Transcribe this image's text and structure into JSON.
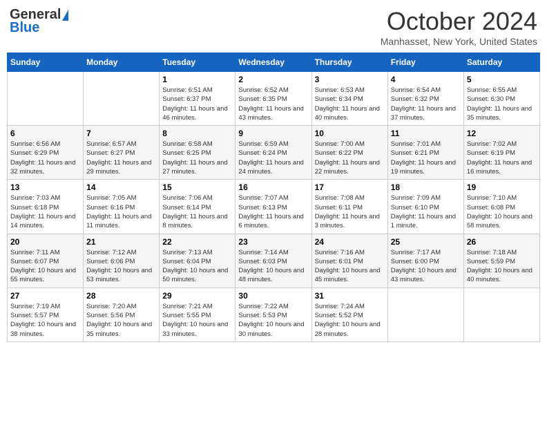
{
  "logo": {
    "general": "General",
    "blue": "Blue"
  },
  "title": "October 2024",
  "location": "Manhasset, New York, United States",
  "weekdays": [
    "Sunday",
    "Monday",
    "Tuesday",
    "Wednesday",
    "Thursday",
    "Friday",
    "Saturday"
  ],
  "weeks": [
    [
      {
        "day": "",
        "info": ""
      },
      {
        "day": "",
        "info": ""
      },
      {
        "day": "1",
        "info": "Sunrise: 6:51 AM\nSunset: 6:37 PM\nDaylight: 11 hours and 46 minutes."
      },
      {
        "day": "2",
        "info": "Sunrise: 6:52 AM\nSunset: 6:35 PM\nDaylight: 11 hours and 43 minutes."
      },
      {
        "day": "3",
        "info": "Sunrise: 6:53 AM\nSunset: 6:34 PM\nDaylight: 11 hours and 40 minutes."
      },
      {
        "day": "4",
        "info": "Sunrise: 6:54 AM\nSunset: 6:32 PM\nDaylight: 11 hours and 37 minutes."
      },
      {
        "day": "5",
        "info": "Sunrise: 6:55 AM\nSunset: 6:30 PM\nDaylight: 11 hours and 35 minutes."
      }
    ],
    [
      {
        "day": "6",
        "info": "Sunrise: 6:56 AM\nSunset: 6:29 PM\nDaylight: 11 hours and 32 minutes."
      },
      {
        "day": "7",
        "info": "Sunrise: 6:57 AM\nSunset: 6:27 PM\nDaylight: 11 hours and 29 minutes."
      },
      {
        "day": "8",
        "info": "Sunrise: 6:58 AM\nSunset: 6:25 PM\nDaylight: 11 hours and 27 minutes."
      },
      {
        "day": "9",
        "info": "Sunrise: 6:59 AM\nSunset: 6:24 PM\nDaylight: 11 hours and 24 minutes."
      },
      {
        "day": "10",
        "info": "Sunrise: 7:00 AM\nSunset: 6:22 PM\nDaylight: 11 hours and 22 minutes."
      },
      {
        "day": "11",
        "info": "Sunrise: 7:01 AM\nSunset: 6:21 PM\nDaylight: 11 hours and 19 minutes."
      },
      {
        "day": "12",
        "info": "Sunrise: 7:02 AM\nSunset: 6:19 PM\nDaylight: 11 hours and 16 minutes."
      }
    ],
    [
      {
        "day": "13",
        "info": "Sunrise: 7:03 AM\nSunset: 6:18 PM\nDaylight: 11 hours and 14 minutes."
      },
      {
        "day": "14",
        "info": "Sunrise: 7:05 AM\nSunset: 6:16 PM\nDaylight: 11 hours and 11 minutes."
      },
      {
        "day": "15",
        "info": "Sunrise: 7:06 AM\nSunset: 6:14 PM\nDaylight: 11 hours and 8 minutes."
      },
      {
        "day": "16",
        "info": "Sunrise: 7:07 AM\nSunset: 6:13 PM\nDaylight: 11 hours and 6 minutes."
      },
      {
        "day": "17",
        "info": "Sunrise: 7:08 AM\nSunset: 6:11 PM\nDaylight: 11 hours and 3 minutes."
      },
      {
        "day": "18",
        "info": "Sunrise: 7:09 AM\nSunset: 6:10 PM\nDaylight: 11 hours and 1 minute."
      },
      {
        "day": "19",
        "info": "Sunrise: 7:10 AM\nSunset: 6:08 PM\nDaylight: 10 hours and 58 minutes."
      }
    ],
    [
      {
        "day": "20",
        "info": "Sunrise: 7:11 AM\nSunset: 6:07 PM\nDaylight: 10 hours and 55 minutes."
      },
      {
        "day": "21",
        "info": "Sunrise: 7:12 AM\nSunset: 6:06 PM\nDaylight: 10 hours and 53 minutes."
      },
      {
        "day": "22",
        "info": "Sunrise: 7:13 AM\nSunset: 6:04 PM\nDaylight: 10 hours and 50 minutes."
      },
      {
        "day": "23",
        "info": "Sunrise: 7:14 AM\nSunset: 6:03 PM\nDaylight: 10 hours and 48 minutes."
      },
      {
        "day": "24",
        "info": "Sunrise: 7:16 AM\nSunset: 6:01 PM\nDaylight: 10 hours and 45 minutes."
      },
      {
        "day": "25",
        "info": "Sunrise: 7:17 AM\nSunset: 6:00 PM\nDaylight: 10 hours and 43 minutes."
      },
      {
        "day": "26",
        "info": "Sunrise: 7:18 AM\nSunset: 5:59 PM\nDaylight: 10 hours and 40 minutes."
      }
    ],
    [
      {
        "day": "27",
        "info": "Sunrise: 7:19 AM\nSunset: 5:57 PM\nDaylight: 10 hours and 38 minutes."
      },
      {
        "day": "28",
        "info": "Sunrise: 7:20 AM\nSunset: 5:56 PM\nDaylight: 10 hours and 35 minutes."
      },
      {
        "day": "29",
        "info": "Sunrise: 7:21 AM\nSunset: 5:55 PM\nDaylight: 10 hours and 33 minutes."
      },
      {
        "day": "30",
        "info": "Sunrise: 7:22 AM\nSunset: 5:53 PM\nDaylight: 10 hours and 30 minutes."
      },
      {
        "day": "31",
        "info": "Sunrise: 7:24 AM\nSunset: 5:52 PM\nDaylight: 10 hours and 28 minutes."
      },
      {
        "day": "",
        "info": ""
      },
      {
        "day": "",
        "info": ""
      }
    ]
  ]
}
